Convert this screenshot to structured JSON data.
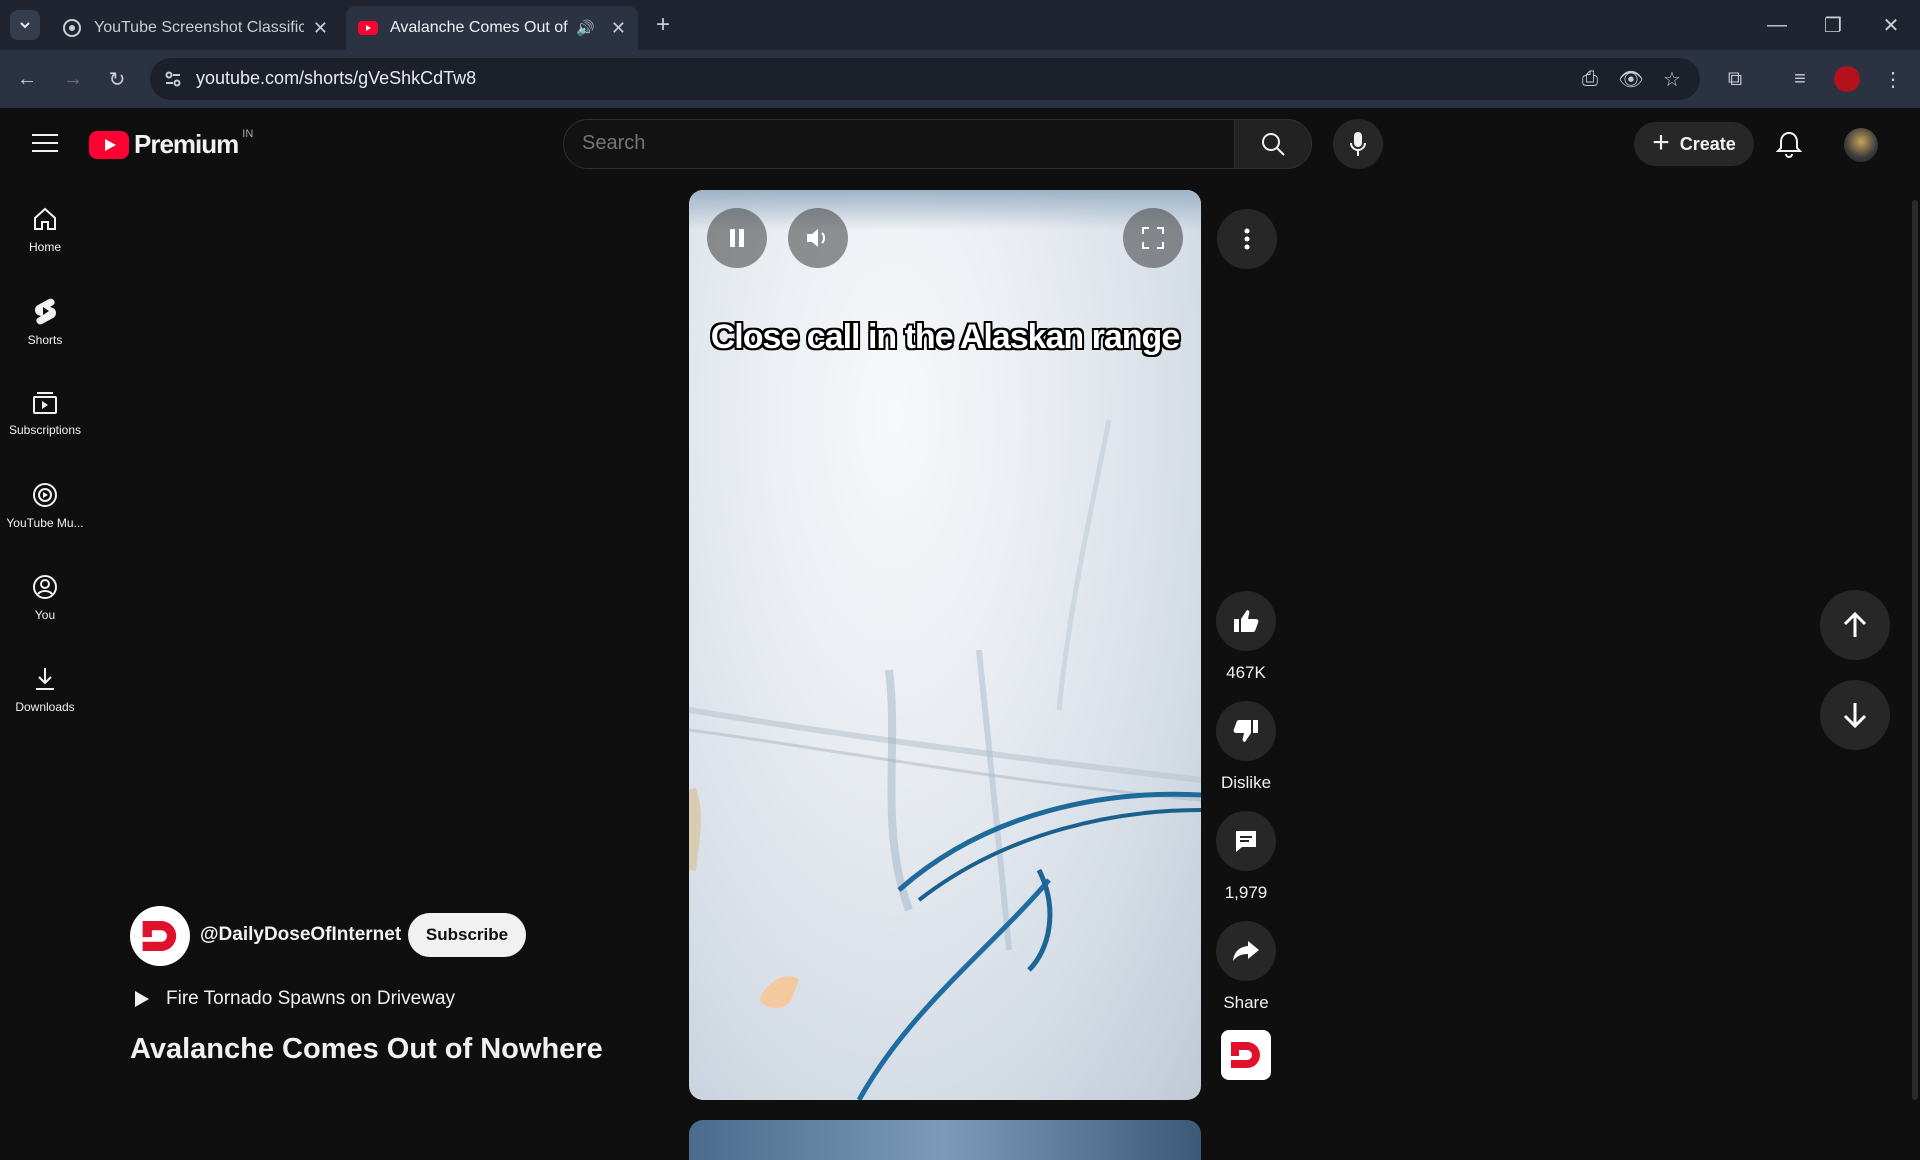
{
  "browser": {
    "tabs": [
      {
        "title": "YouTube Screenshot Classificati",
        "active": false
      },
      {
        "title": "Avalanche Comes Out of Nowhere",
        "active": true
      }
    ],
    "url": "youtube.com/shorts/gVeShkCdTw8"
  },
  "header": {
    "brand": "Premium",
    "region": "IN",
    "search_placeholder": "Search",
    "create_label": "Create"
  },
  "sidebar": {
    "items": [
      {
        "label": "Home",
        "icon": "home-icon"
      },
      {
        "label": "Shorts",
        "icon": "shorts-icon"
      },
      {
        "label": "Subscriptions",
        "icon": "subscriptions-icon"
      },
      {
        "label": "YouTube Mu...",
        "icon": "youtube-music-icon"
      },
      {
        "label": "You",
        "icon": "you-icon"
      },
      {
        "label": "Downloads",
        "icon": "download-icon"
      }
    ]
  },
  "video": {
    "caption": "Close call in the Alaskan range"
  },
  "actions": {
    "likes": "467K",
    "dislike": "Dislike",
    "comments": "1,979",
    "share": "Share"
  },
  "channel": {
    "handle": "@DailyDoseOfInternet",
    "subscribe": "Subscribe",
    "related": "Fire Tornado Spawns on Driveway",
    "title": "Avalanche Comes Out of Nowhere"
  },
  "colors": {
    "accent_red": "#ff0033",
    "background": "#0f0f0f"
  }
}
